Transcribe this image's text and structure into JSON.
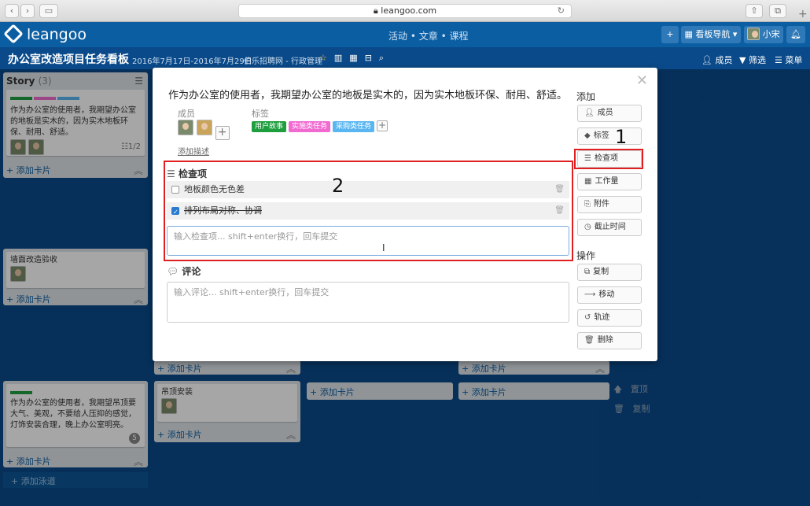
{
  "browser": {
    "url": "leangoo.com",
    "reload_icon": "reload-icon"
  },
  "app": {
    "logo": "leangoo",
    "nav": {
      "item1": "活动",
      "item2": "文章",
      "item3": "课程"
    },
    "board_nav_label": "看板导航",
    "user_name": "小宋"
  },
  "board": {
    "title": "办公室改造项目任务看板",
    "date_range": "2016年7月17日-2016年7月29日",
    "org": "伯乐招聘网 - 行政管理",
    "members_label": "成员",
    "filter_label": "筛选",
    "menu_label": "菜单",
    "add_swimlane": "添加泳道"
  },
  "background": {
    "story_list_title": "Story",
    "story_count": "(3)",
    "card1_text": "作为办公室的使用者，我期望办公室的地板是实木的，因为实木地板环保、耐用、舒适。",
    "card1_checklist": "1/2",
    "add_card": "添加卡片",
    "card2_text": "墙面改造验收",
    "card3_text": "作为办公室的使用者，我期望吊顶要大气、美观，不要给人压抑的感觉，灯饰安装合理，晚上办公室明亮。",
    "card3_count": "5",
    "card4_text": "吊顶安装",
    "move_up": "置顶",
    "copy": "复制"
  },
  "modal": {
    "title": "作为办公室的使用者，我期望办公室的地板是实木的，因为实木地板环保、耐用、舒适。",
    "members_label": "成员",
    "tags_label": "标签",
    "tags": [
      "用户故事",
      "实施类任务",
      "采购类任务"
    ],
    "add_description": "添加描述",
    "checklist_title": "检查项",
    "checklist_items": [
      {
        "text": "地板颜色无色差",
        "checked": false
      },
      {
        "text": "排列布局对称、协调",
        "checked": true
      }
    ],
    "checklist_placeholder": "输入检查项... shift+enter换行，回车提交",
    "comment_title": "评论",
    "comment_placeholder": "输入评论... shift+enter换行，回车提交",
    "sidebar": {
      "add_title": "添加",
      "members": "成员",
      "tags": "标签",
      "checklist": "检查项",
      "workload": "工作量",
      "attachment": "附件",
      "deadline": "截止时间",
      "actions_title": "操作",
      "copy": "复制",
      "move": "移动",
      "track": "轨迹",
      "delete": "删除"
    }
  },
  "annotations": {
    "one": "1",
    "two": "2"
  },
  "colors": {
    "header": "#0c5ea3",
    "board_bg": "#0a4a8a",
    "highlight": "#e02020",
    "tag_green": "#1e9e3e",
    "tag_pink": "#f06ad0",
    "tag_blue": "#5ab6f0"
  }
}
